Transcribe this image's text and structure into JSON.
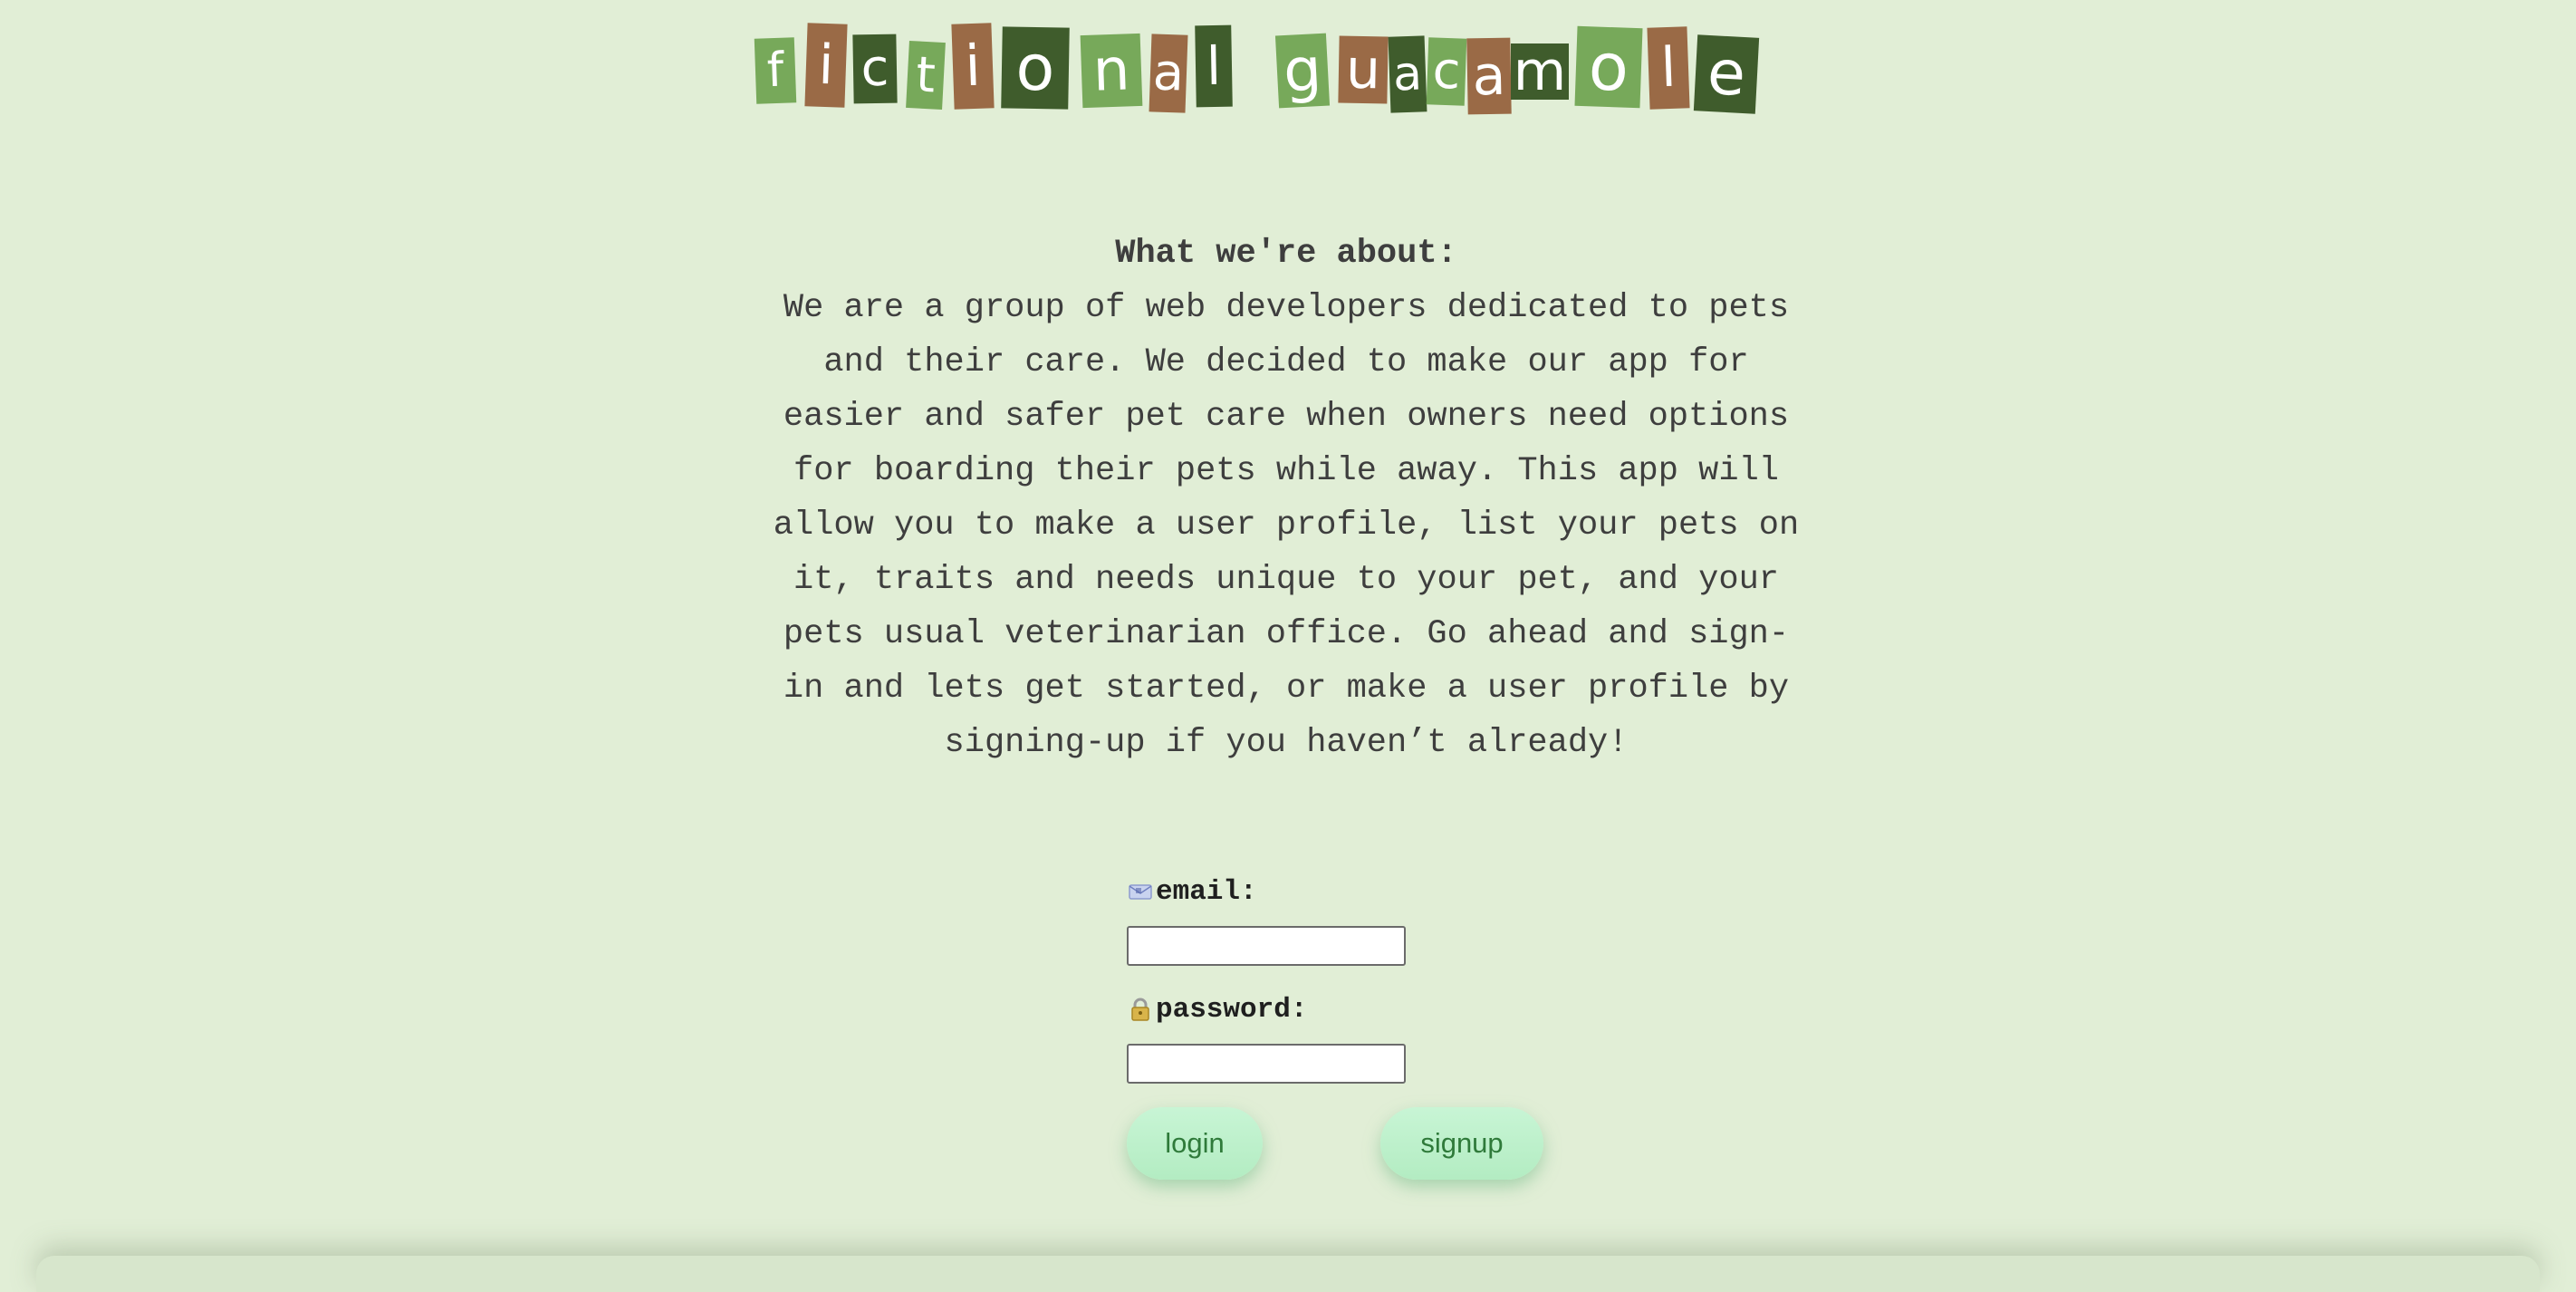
{
  "logo": {
    "text": "fictional guacamole",
    "tiles": [
      {
        "ch": "f",
        "bg": "#77a95a",
        "fg": "#ffffff"
      },
      {
        "ch": "i",
        "bg": "#9a6a46",
        "fg": "#ffffff"
      },
      {
        "ch": "c",
        "bg": "#3f5c2c",
        "fg": "#ffffff"
      },
      {
        "ch": "t",
        "bg": "#77a95a",
        "fg": "#ffffff"
      },
      {
        "ch": "i",
        "bg": "#9a6a46",
        "fg": "#ffffff"
      },
      {
        "ch": "o",
        "bg": "#3f5c2c",
        "fg": "#ffffff"
      },
      {
        "ch": "n",
        "bg": "#77a95a",
        "fg": "#ffffff"
      },
      {
        "ch": "a",
        "bg": "#9a6a46",
        "fg": "#ffffff"
      },
      {
        "ch": "l",
        "bg": "#3f5c2c",
        "fg": "#ffffff"
      },
      {
        "ch": "g",
        "bg": "#77a95a",
        "fg": "#ffffff"
      },
      {
        "ch": "u",
        "bg": "#9a6a46",
        "fg": "#ffffff"
      },
      {
        "ch": "a",
        "bg": "#3f5c2c",
        "fg": "#ffffff"
      },
      {
        "ch": "c",
        "bg": "#77a95a",
        "fg": "#ffffff"
      },
      {
        "ch": "a",
        "bg": "#9a6a46",
        "fg": "#ffffff"
      },
      {
        "ch": "m",
        "bg": "#3f5c2c",
        "fg": "#ffffff"
      },
      {
        "ch": "o",
        "bg": "#77a95a",
        "fg": "#ffffff"
      },
      {
        "ch": "l",
        "bg": "#9a6a46",
        "fg": "#ffffff"
      },
      {
        "ch": "e",
        "bg": "#3f5c2c",
        "fg": "#ffffff"
      }
    ]
  },
  "about": {
    "title": "What we're about:",
    "body": "We are a group of web developers dedicated to pets and their care. We decided to make our app for easier and safer pet care when owners need options for boarding their pets while away. This app will allow you to make a user profile, list your pets on it, traits and needs unique to your pet, and your pets usual veterinarian office. Go ahead and sign-in and lets get started, or make a user profile by signing-up if you haven’t already!"
  },
  "form": {
    "email_label": "email:",
    "email_icon": "envelope-icon",
    "email_value": "",
    "password_label": "password:",
    "password_icon": "lock-icon",
    "password_value": "",
    "login_label": "login",
    "signup_label": "signup"
  },
  "colors": {
    "background": "#e1eed6",
    "text": "#3e3e3e",
    "button_bg": "#bff0cc",
    "button_text": "#2f7a3a",
    "tile_light_green": "#77a95a",
    "tile_brown": "#9a6a46",
    "tile_dark_green": "#3f5c2c"
  }
}
